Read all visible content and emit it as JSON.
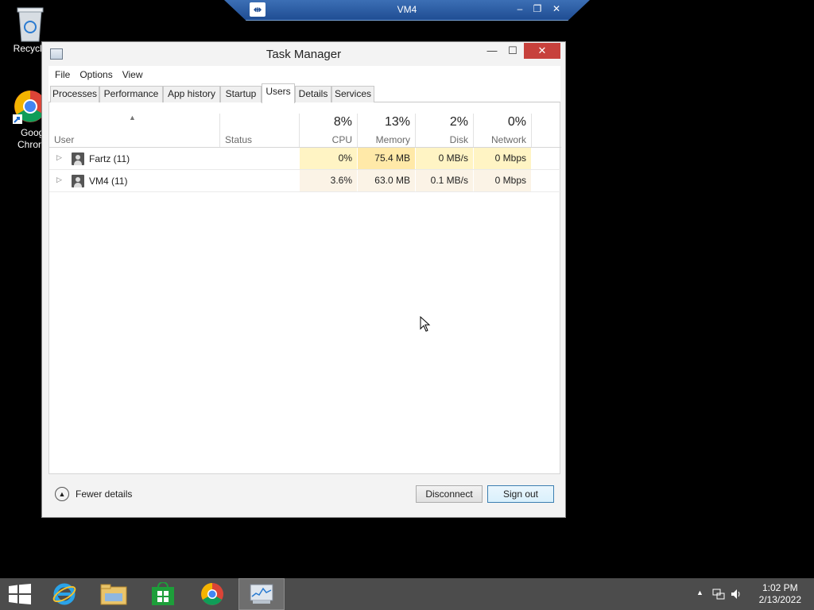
{
  "desktop": {
    "icons": [
      {
        "label": "Recycle",
        "name": "recycle-bin"
      },
      {
        "label": "Googl\nChrom",
        "name": "google-chrome"
      }
    ]
  },
  "rdp_bar": {
    "title": "VM4",
    "pin_icon": "pin-icon",
    "controls": [
      "minimize",
      "restore",
      "close"
    ]
  },
  "window": {
    "title": "Task Manager",
    "controls": {
      "minimize": "—",
      "maximize": "☐",
      "close": "✕"
    }
  },
  "menu": [
    "File",
    "Options",
    "View"
  ],
  "tabs": [
    "Processes",
    "Performance",
    "App history",
    "Startup",
    "Users",
    "Details",
    "Services"
  ],
  "active_tab": "Users",
  "columns": {
    "user": "User",
    "status": "Status",
    "cpu": {
      "pct": "8%",
      "name": "CPU"
    },
    "memory": {
      "pct": "13%",
      "name": "Memory"
    },
    "disk": {
      "pct": "2%",
      "name": "Disk"
    },
    "network": {
      "pct": "0%",
      "name": "Network"
    }
  },
  "rows": [
    {
      "user": "Fartz (11)",
      "status": "",
      "cpu": "0%",
      "memory": "75.4 MB",
      "disk": "0 MB/s",
      "network": "0 Mbps"
    },
    {
      "user": "VM4 (11)",
      "status": "",
      "cpu": "3.6%",
      "memory": "63.0 MB",
      "disk": "0.1 MB/s",
      "network": "0 Mbps"
    }
  ],
  "footer": {
    "fewer_details": "Fewer details",
    "disconnect": "Disconnect",
    "sign_out": "Sign out"
  },
  "taskbar": {
    "items": [
      "start-button",
      "internet-explorer",
      "file-explorer",
      "store",
      "chrome",
      "task-manager"
    ],
    "time": "1:02 PM",
    "date": "2/13/2022"
  },
  "colors": {
    "heat_light": "#fff4c4",
    "heat_mid": "#ffe9a8",
    "heat_faint": "#fbf3e6",
    "close_red": "#c7413c",
    "rdp_blue": "#1f4d93"
  }
}
